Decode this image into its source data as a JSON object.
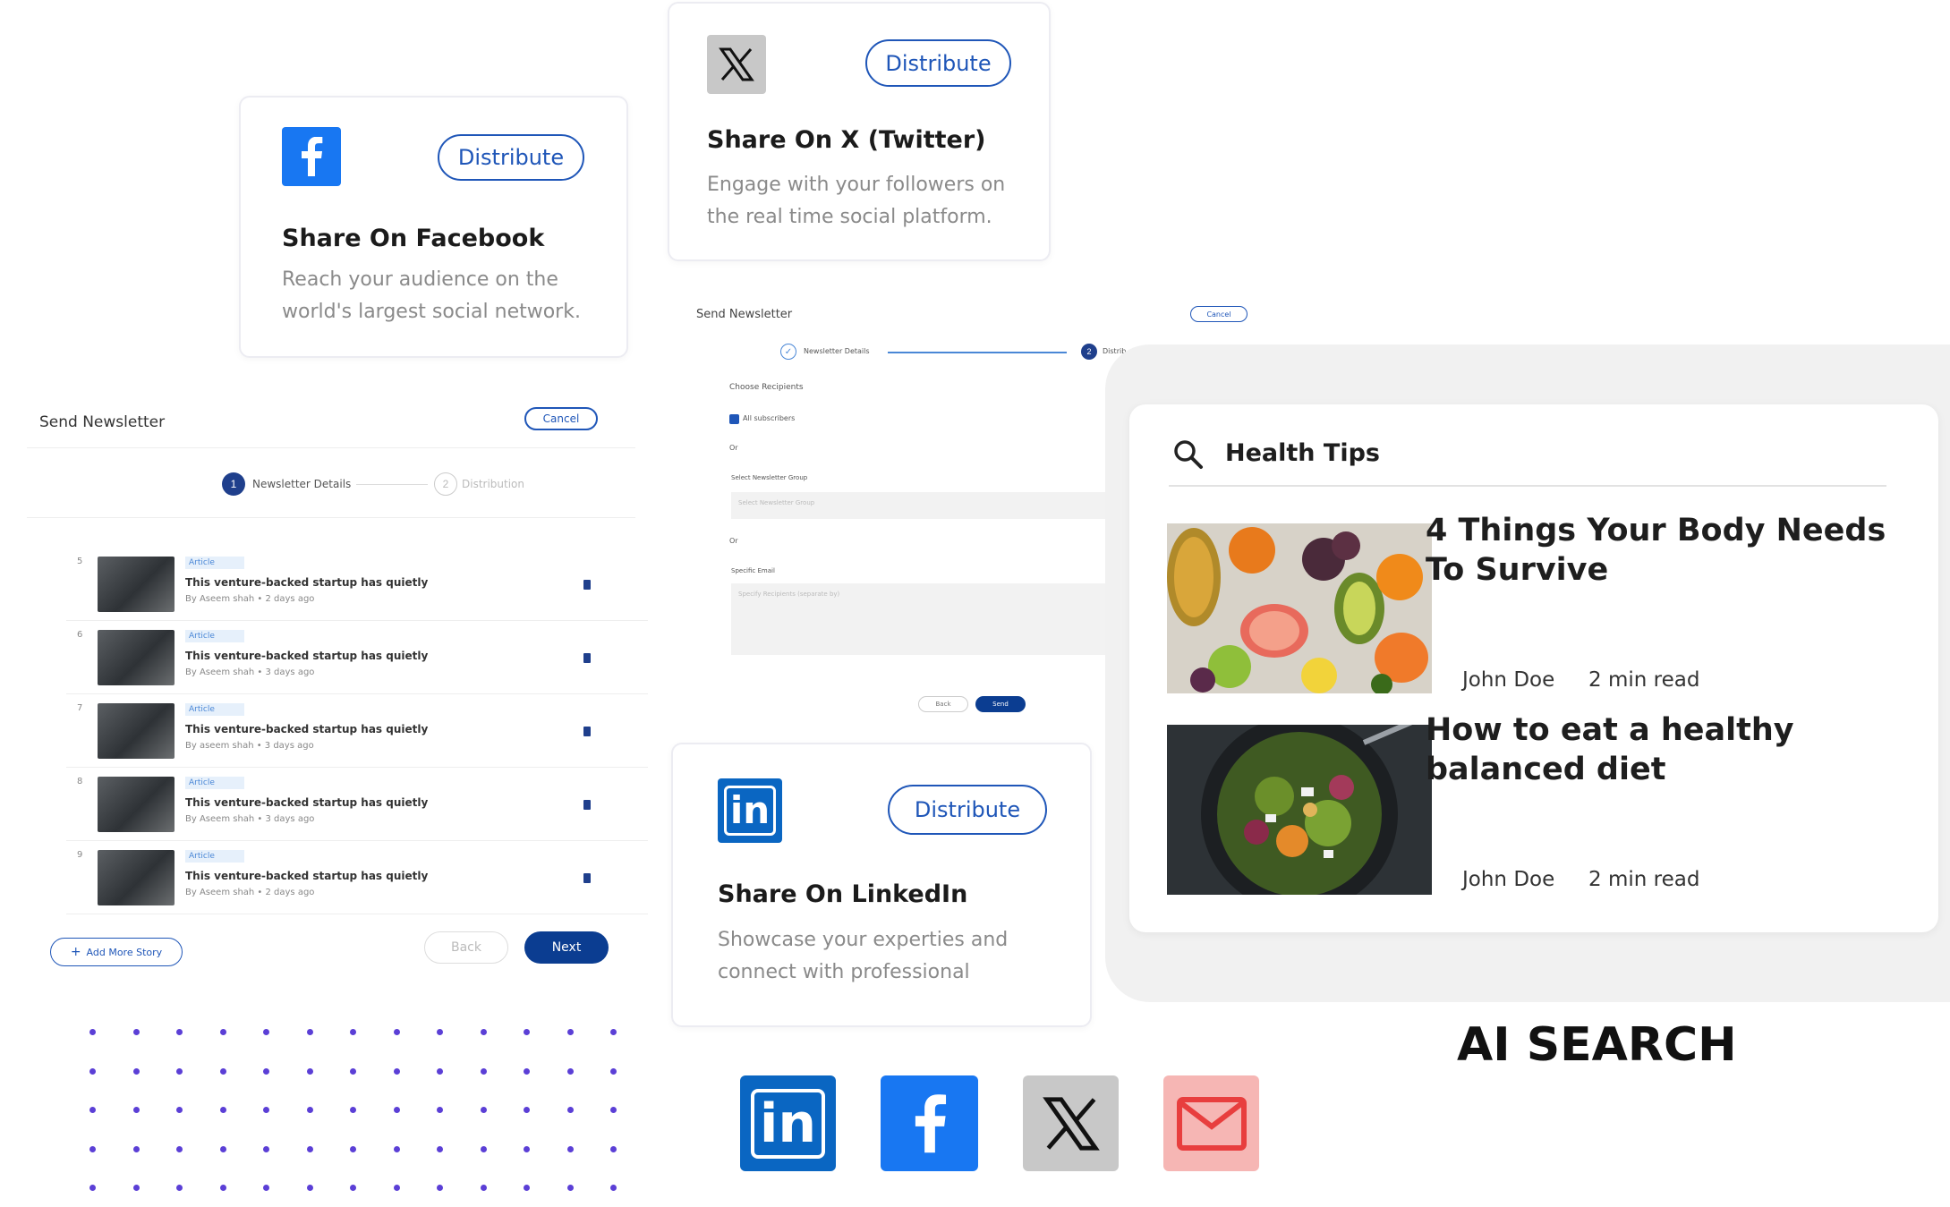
{
  "facebook_card": {
    "title": "Share On Facebook",
    "desc_line1": "Reach your audience on the",
    "desc_line2": "world's largest social network.",
    "button": "Distribute",
    "icon": "facebook-icon"
  },
  "x_card": {
    "title": "Share On X (Twitter)",
    "desc_line1": "Engage with your followers on",
    "desc_line2": "the real time social platform.",
    "button": "Distribute",
    "icon": "x-icon"
  },
  "linkedin_card": {
    "title": "Share On LinkedIn",
    "desc_line1": "Showcase your experties and",
    "desc_line2": "connect with professional",
    "button": "Distribute",
    "icon": "linkedin-icon"
  },
  "newsletter_left": {
    "title": "Send Newsletter",
    "cancel": "Cancel",
    "step1_num": "1",
    "step1": "Newsletter Details",
    "step2_num": "2",
    "step2": "Distribution",
    "stories": [
      {
        "num": "5",
        "tag": "Article",
        "title": "This venture-backed startup has quietly",
        "meta": "By Aseem shah • 2 days ago"
      },
      {
        "num": "6",
        "tag": "Article",
        "title": "This venture-backed startup has quietly",
        "meta": "By Aseem shah • 3 days ago"
      },
      {
        "num": "7",
        "tag": "Article",
        "title": "This venture-backed startup has quietly",
        "meta": "By aseem shah • 3 days ago"
      },
      {
        "num": "8",
        "tag": "Article",
        "title": "This venture-backed startup has quietly",
        "meta": "By Aseem shah • 3 days ago"
      },
      {
        "num": "9",
        "tag": "Article",
        "title": "This venture-backed startup has quietly",
        "meta": "By Aseem shah • 2 days ago"
      }
    ],
    "add_more": "Add More Story",
    "back": "Back",
    "next": "Next"
  },
  "newsletter_mid": {
    "title": "Send Newsletter",
    "cancel": "Cancel",
    "step1": "Newsletter Details",
    "step2_num": "2",
    "step2": "Distrib",
    "choose_recipients": "Choose Recipients",
    "all_subscribers": "All subscribers",
    "or1": "Or",
    "select_group_label": "Select Newsletter Group",
    "select_group_placeholder": "Select Newsletter Group",
    "or2": "Or",
    "specific_email_label": "Specific Email",
    "specific_email_placeholder": "Specify Recipients (separate by)",
    "back": "Back",
    "send": "Send"
  },
  "ai_search": {
    "query": "Health Tips",
    "results": [
      {
        "title_line1": "4 Things Your Body Needs",
        "title_line2": "To Survive",
        "author": "John Doe",
        "read": "2 min read"
      },
      {
        "title_line1": "How to eat a healthy",
        "title_line2": "balanced diet",
        "author": "John Doe",
        "read": "2 min read"
      }
    ],
    "label": "AI SEARCH"
  },
  "colors": {
    "primary": "#1f56b8",
    "facebook": "#1877f2",
    "linkedin": "#0a66c2",
    "navy": "#0b3d91",
    "dots": "#5b3fd6",
    "mail_bg": "#f6b6b4",
    "mail_fg": "#e83e3e"
  }
}
